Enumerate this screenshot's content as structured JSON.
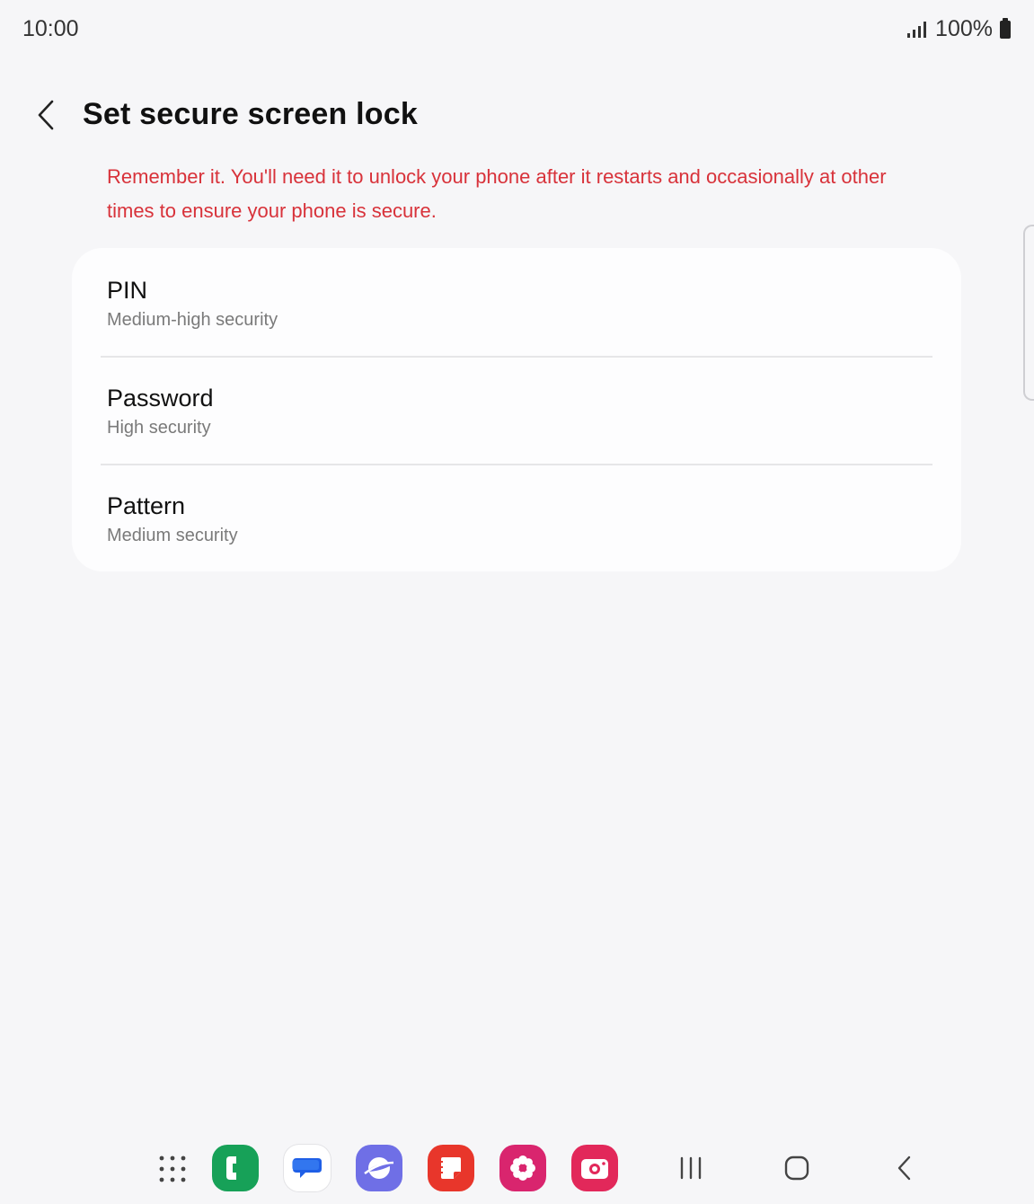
{
  "status_bar": {
    "time": "10:00",
    "battery_text": "100%",
    "icons": [
      "signal-icon",
      "battery-icon"
    ]
  },
  "header": {
    "title": "Set secure screen lock",
    "back_icon": "chevron-left-icon"
  },
  "warning_text": "Remember it. You'll need it to unlock your phone after it restarts and occasionally at other times to ensure your phone is secure.",
  "options": [
    {
      "title": "PIN",
      "subtitle": "Medium-high security"
    },
    {
      "title": "Password",
      "subtitle": "High security"
    },
    {
      "title": "Pattern",
      "subtitle": "Medium security"
    }
  ],
  "taskbar": {
    "apps": [
      {
        "name": "phone-icon",
        "color": "#17a158"
      },
      {
        "name": "messages-icon",
        "color": "#ffffff"
      },
      {
        "name": "internet-icon",
        "color": "#6f6fe6"
      },
      {
        "name": "notes-icon",
        "color": "#e8362b"
      },
      {
        "name": "gallery-icon",
        "color": "#d9256e"
      },
      {
        "name": "camera-icon",
        "color": "#e2285a"
      }
    ],
    "nav": [
      "recents-icon",
      "home-icon",
      "back-nav-icon"
    ]
  },
  "colors": {
    "warning": "#d8323a",
    "background": "#f6f6f8",
    "card": "#fdfdfe"
  }
}
